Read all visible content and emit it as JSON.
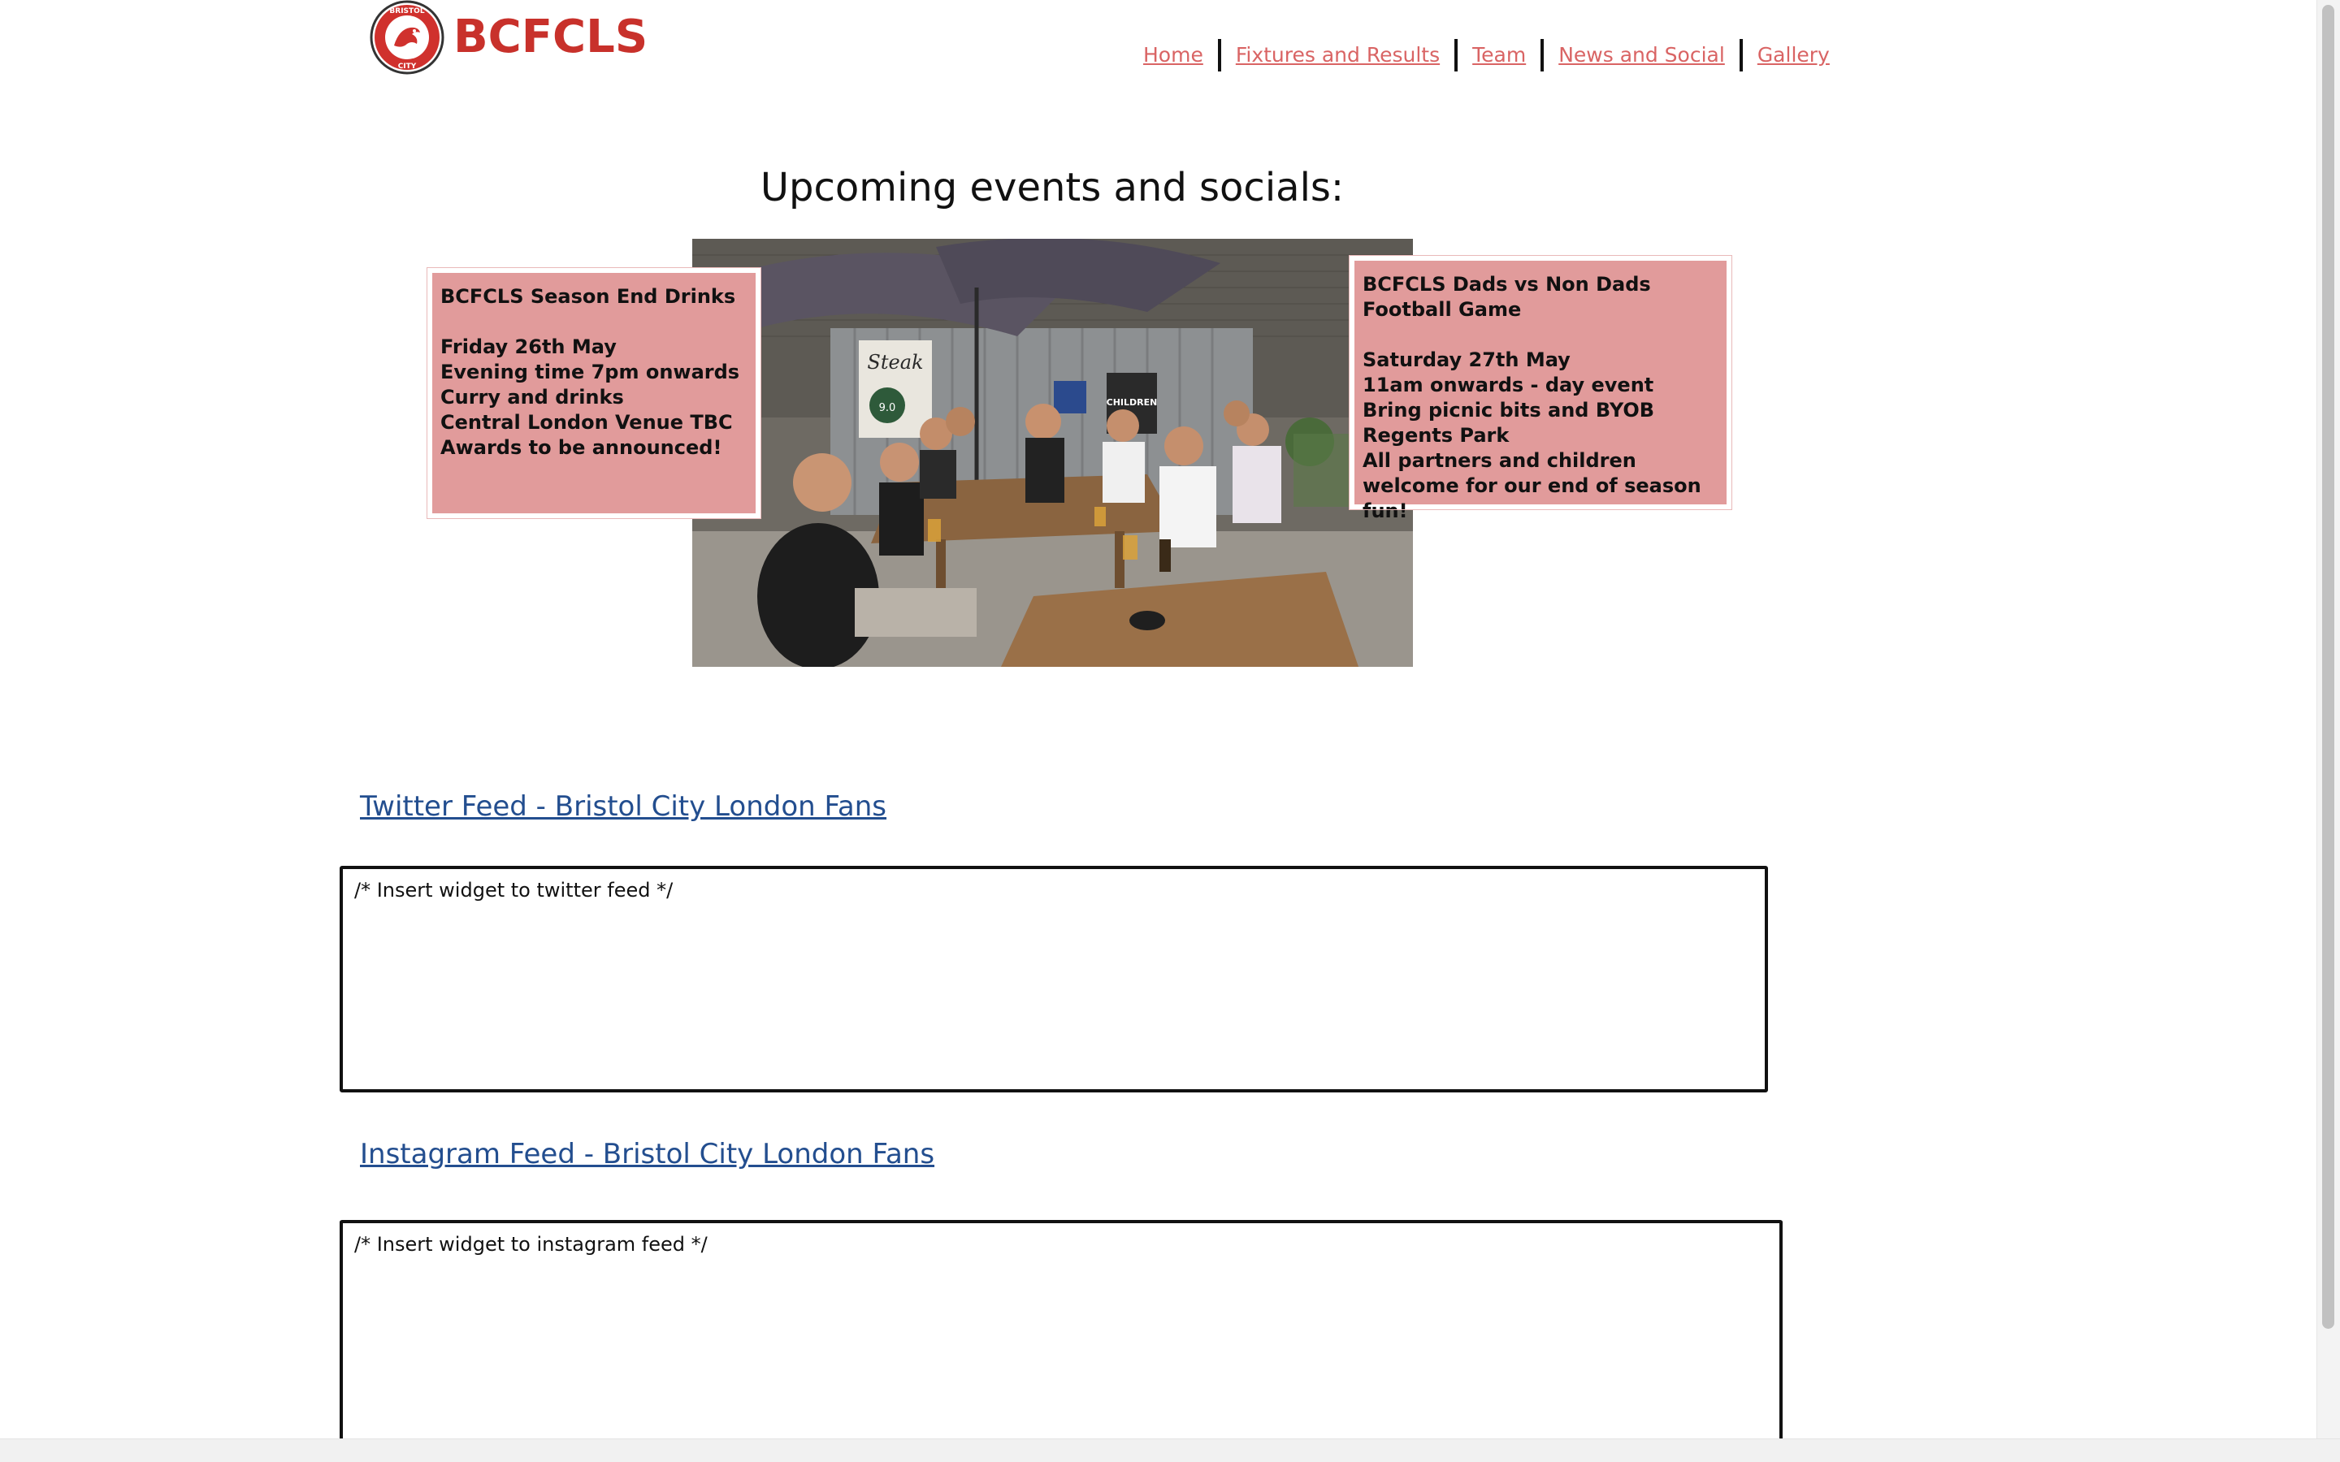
{
  "header": {
    "logo_text": "BCFCLS",
    "badge_top_text": "BRISTOL",
    "badge_bottom_text": "CITY",
    "brand_color": "#c8312b"
  },
  "nav": {
    "items": [
      {
        "label": "Home"
      },
      {
        "label": "Fixtures and Results"
      },
      {
        "label": "Team"
      },
      {
        "label": "News and Social"
      },
      {
        "label": "Gallery"
      }
    ],
    "link_color": "#d96464"
  },
  "events": {
    "title": "Upcoming events and socials:",
    "left_card": {
      "text": "BCFCLS Season End Drinks\n\nFriday 26th May\nEvening time 7pm onwards\nCurry and drinks\nCentral London Venue TBC\nAwards to be announced!"
    },
    "right_card": {
      "text": "BCFCLS Dads vs Non Dads Football Game\n\nSaturday 27th May\n11am onwards - day event\nBring picnic bits and BYOB\nRegents Park\nAll partners and children welcome for our end of season fun!"
    },
    "card_color": "#e19b9b",
    "photo_signs": {
      "steak": "Steak",
      "children": "CHILDREN",
      "price": "9.0"
    }
  },
  "feeds": {
    "twitter": {
      "heading": "Twitter Feed - Bristol City London Fans",
      "placeholder": "/* Insert widget to twitter feed */"
    },
    "instagram": {
      "heading": "Instagram Feed - Bristol City London Fans",
      "placeholder": "/* Insert widget to instagram feed */"
    },
    "heading_color": "#234e8f"
  }
}
